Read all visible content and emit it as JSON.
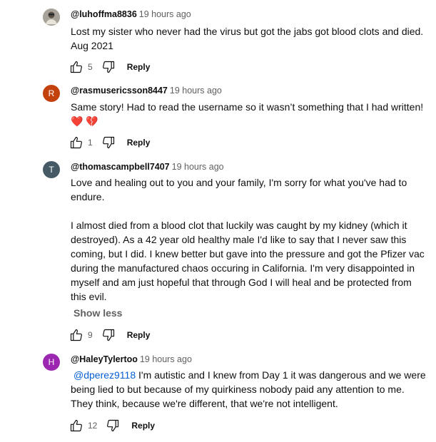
{
  "comments": [
    {
      "avatar": {
        "letter": "",
        "color": "#8a8a8a"
      },
      "handle": "@luhoffma8836",
      "time": "19 hours ago",
      "lines": [
        "Lost my sister who never had the virus but got the jabs got blood clots and died.",
        "Aug 2021"
      ],
      "likes": "5",
      "reply": "Reply"
    },
    {
      "avatar": {
        "letter": "R",
        "color": "#c2410c"
      },
      "handle": "@rasmusericsson8447",
      "time": "19 hours ago",
      "lines": [
        "Same story! Had to read the username so it wasn’t something that I had written!",
        "❤️ 💔"
      ],
      "likes": "1",
      "reply": "Reply"
    },
    {
      "avatar": {
        "letter": "T",
        "color": "#455a64"
      },
      "handle": "@thomascampbell7407",
      "time": "19 hours ago",
      "lines": [
        "Love and healing out to you and your family, I'm sorry for what you've had to",
        "endure.",
        "",
        "I almost died from a blood clot that luckily was caught by my kidney (which it",
        "destroyed). As a 42 year old healthy male I'd like to say that I never saw this",
        "coming, but I did.  I knew better but gave into the pressure and got the Pfizer vac",
        "during the manufactured chaos occuring in California.  I'm very disappointed in",
        "myself and am just hopeful that through God I will heal and be protected from",
        "this evil."
      ],
      "show_less": "Show less",
      "likes": "9",
      "reply": "Reply"
    },
    {
      "avatar": {
        "letter": "H",
        "color": "#9c27b0"
      },
      "handle": "@HaleyTylertoo",
      "time": "19 hours ago",
      "mention": "@dperez9118",
      "first_line_rest": " I'm autistic and I knew from Day 1 it was dangerous and we were",
      "lines": [
        "being lied to but because of my quirkiness nobody paid any attention to me.",
        "They think, because we're different, that we're not intelligent."
      ],
      "likes": "12",
      "reply": "Reply"
    }
  ]
}
